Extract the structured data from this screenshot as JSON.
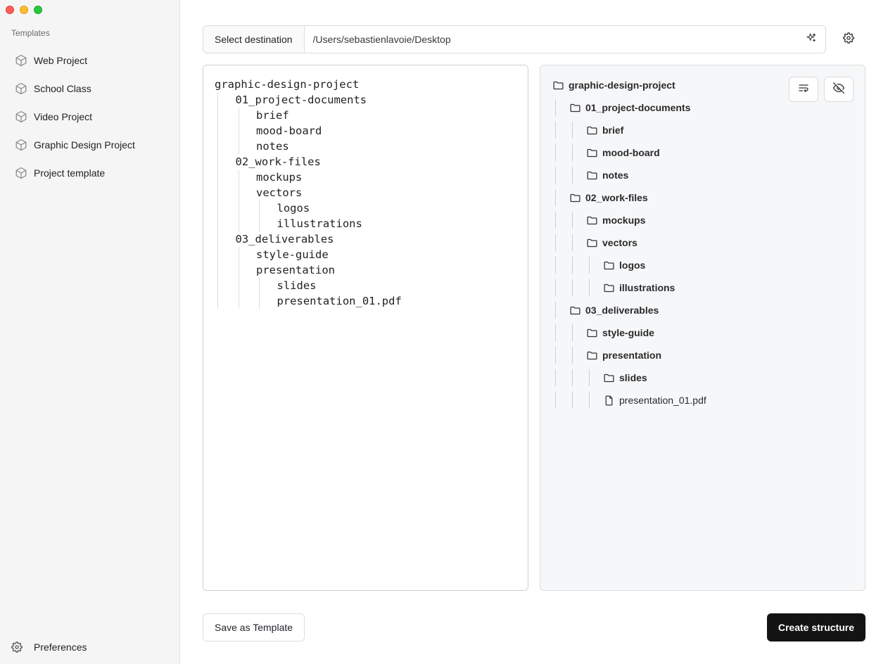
{
  "sidebar": {
    "heading": "Templates",
    "items": [
      {
        "label": "Web Project",
        "icon": "cube-icon"
      },
      {
        "label": "School Class",
        "icon": "cube-icon"
      },
      {
        "label": "Video Project",
        "icon": "cube-icon"
      },
      {
        "label": "Graphic Design Project",
        "icon": "cube-icon"
      },
      {
        "label": "Project template",
        "icon": "cube-icon"
      }
    ],
    "preferences_label": "Preferences"
  },
  "destination": {
    "button_label": "Select destination",
    "path": "/Users/sebastienlavoie/Desktop"
  },
  "editor": {
    "lines": [
      {
        "depth": 0,
        "text": "graphic-design-project"
      },
      {
        "depth": 1,
        "text": "01_project-documents"
      },
      {
        "depth": 2,
        "text": "brief"
      },
      {
        "depth": 2,
        "text": "mood-board"
      },
      {
        "depth": 2,
        "text": "notes"
      },
      {
        "depth": 1,
        "text": "02_work-files"
      },
      {
        "depth": 2,
        "text": "mockups"
      },
      {
        "depth": 2,
        "text": "vectors"
      },
      {
        "depth": 3,
        "text": "logos"
      },
      {
        "depth": 3,
        "text": "illustrations"
      },
      {
        "depth": 1,
        "text": "03_deliverables"
      },
      {
        "depth": 2,
        "text": "style-guide"
      },
      {
        "depth": 2,
        "text": "presentation"
      },
      {
        "depth": 3,
        "text": "slides"
      },
      {
        "depth": 3,
        "text": "presentation_01.pdf"
      }
    ]
  },
  "preview": {
    "tree": [
      {
        "depth": 0,
        "label": "graphic-design-project",
        "type": "folder"
      },
      {
        "depth": 1,
        "label": "01_project-documents",
        "type": "folder"
      },
      {
        "depth": 2,
        "label": "brief",
        "type": "folder"
      },
      {
        "depth": 2,
        "label": "mood-board",
        "type": "folder"
      },
      {
        "depth": 2,
        "label": "notes",
        "type": "folder"
      },
      {
        "depth": 1,
        "label": "02_work-files",
        "type": "folder"
      },
      {
        "depth": 2,
        "label": "mockups",
        "type": "folder"
      },
      {
        "depth": 2,
        "label": "vectors",
        "type": "folder"
      },
      {
        "depth": 3,
        "label": "logos",
        "type": "folder"
      },
      {
        "depth": 3,
        "label": "illustrations",
        "type": "folder"
      },
      {
        "depth": 1,
        "label": "03_deliverables",
        "type": "folder"
      },
      {
        "depth": 2,
        "label": "style-guide",
        "type": "folder"
      },
      {
        "depth": 2,
        "label": "presentation",
        "type": "folder"
      },
      {
        "depth": 3,
        "label": "slides",
        "type": "folder"
      },
      {
        "depth": 3,
        "label": "presentation_01.pdf",
        "type": "file"
      }
    ]
  },
  "footer": {
    "save_label": "Save as Template",
    "create_label": "Create structure"
  },
  "colors": {
    "primary_button": "#141414",
    "sidebar_bg": "#f5f5f5",
    "preview_bg": "#f6f7f9"
  }
}
